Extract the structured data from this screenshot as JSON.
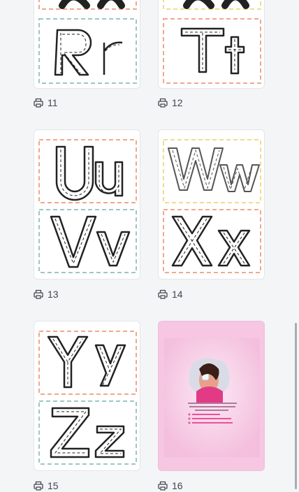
{
  "pages": [
    {
      "number": "11",
      "letters": "Rr"
    },
    {
      "number": "12",
      "letters": "Tt"
    },
    {
      "number": "13",
      "letters": "Uu Vv"
    },
    {
      "number": "14",
      "letters": "Ww Xx"
    },
    {
      "number": "15",
      "letters": "Yy Zz"
    },
    {
      "number": "16",
      "letters": ""
    }
  ],
  "icons": {
    "page_icon": "printer-icon"
  },
  "colors": {
    "orange_dash": "#f0a88e",
    "teal_dash": "#9cc7c6",
    "yellow_dash": "#f1dc8e",
    "pink_page": "#f6c6e2",
    "accent_pink": "#ec4f9a"
  }
}
